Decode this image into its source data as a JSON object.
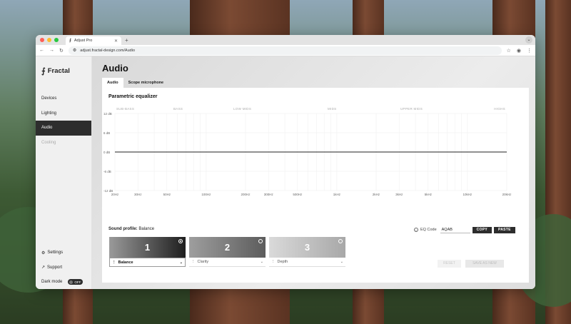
{
  "browser": {
    "tab_title": "Adjust Pro",
    "tab_close": "✕",
    "new_tab": "+",
    "menu": "⌄",
    "url": "adjust.fractal-design.com/Audio",
    "nav_back": "←",
    "nav_forward": "→",
    "nav_reload": "↻",
    "star": "☆",
    "profile": "◉",
    "more": "⋮"
  },
  "sidebar": {
    "logo": "Fractal",
    "logo_mark": "⨍",
    "items": [
      {
        "label": "Devices"
      },
      {
        "label": "Lighting"
      },
      {
        "label": "Audio"
      },
      {
        "label": "Cooling"
      }
    ],
    "settings": "Settings",
    "support": "Support",
    "dark_mode": "Dark mode",
    "dark_mode_state": "OFF"
  },
  "main": {
    "title": "Audio",
    "tabs": [
      {
        "label": "Audio"
      },
      {
        "label": "Scope microphone"
      }
    ],
    "eq_title": "Parametric equalizer",
    "profile_label": "Sound profile:",
    "profile_value": "Balance",
    "eq_code_label": "EQ Code",
    "eq_code_value": "AQAB",
    "copy": "COPY",
    "paste": "PASTE",
    "reset": "RESET",
    "save_as_new": "SAVE AS NEW",
    "cards": [
      {
        "number": "1",
        "name": "Balance",
        "selected": true
      },
      {
        "number": "2",
        "name": "Clarity",
        "selected": false
      },
      {
        "number": "3",
        "name": "Depth",
        "selected": false
      }
    ]
  },
  "chart_data": {
    "type": "line",
    "band_labels": [
      "SUB-BASS",
      "BASS",
      "LOW MIDS",
      "MIDS",
      "UPPER MIDS",
      "HIGHS"
    ],
    "y_ticks": [
      "12 dB",
      "6 dB",
      "0 dB",
      "-6 dB",
      "-12 dB"
    ],
    "ylim": [
      -12,
      12
    ],
    "x_ticks": [
      "20Hz",
      "30Hz",
      "50Hz",
      "100Hz",
      "200Hz",
      "300Hz",
      "500Hz",
      "1kHz",
      "2kHz",
      "3kHz",
      "5kHz",
      "10kHz",
      "20kHz"
    ],
    "x_tick_values": [
      20,
      30,
      50,
      100,
      200,
      300,
      500,
      1000,
      2000,
      3000,
      5000,
      10000,
      20000
    ],
    "x_scale": "log",
    "series": [
      {
        "x": [
          20,
          20000
        ],
        "y": [
          0,
          0
        ]
      }
    ],
    "grid": true
  }
}
